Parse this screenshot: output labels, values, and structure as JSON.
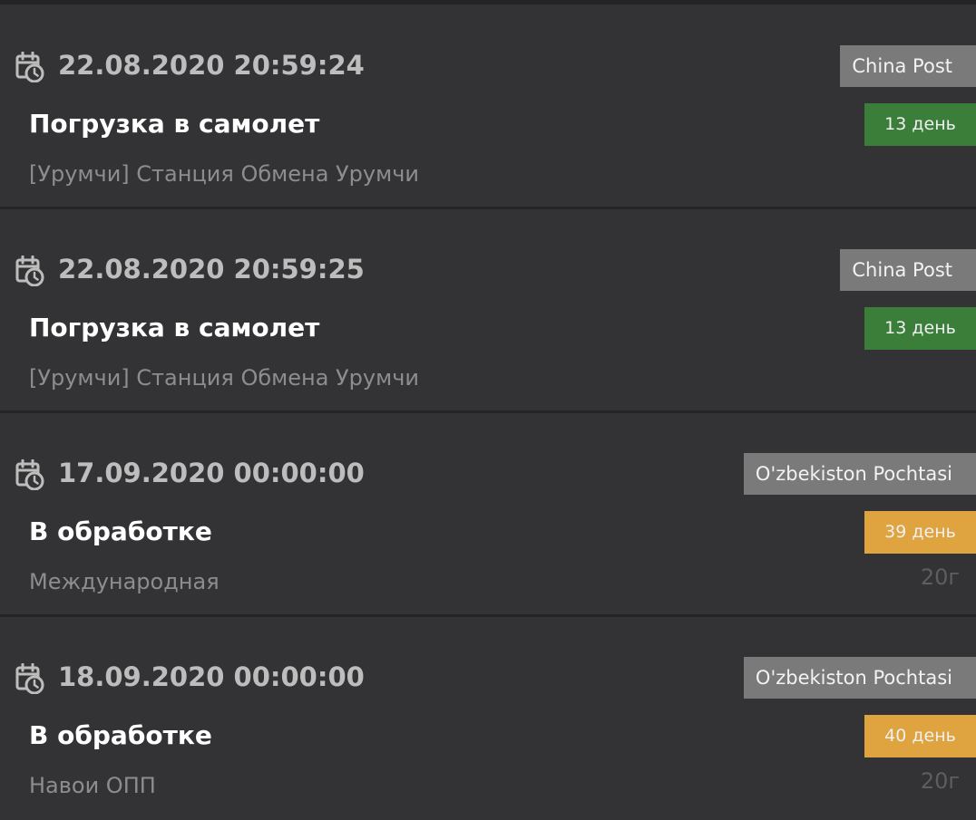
{
  "events": [
    {
      "datetime": "22.08.2020 20:59:24",
      "carrier": "China Post",
      "status": "Погрузка в самолет",
      "days": "13 день",
      "days_color": "#3b7e3a",
      "location": "[Урумчи] Станция Обмена Урумчи",
      "weight": "",
      "icon": "calendar-clock-icon"
    },
    {
      "datetime": "22.08.2020 20:59:25",
      "carrier": "China Post",
      "status": "Погрузка в самолет",
      "days": "13 день",
      "days_color": "#3b7e3a",
      "location": "[Урумчи] Станция Обмена Урумчи",
      "weight": "",
      "icon": "calendar-clock-icon"
    },
    {
      "datetime": "17.09.2020 00:00:00",
      "carrier": "O'zbekiston Pochtasi",
      "status": "В обработке",
      "days": "39 день",
      "days_color": "#dfa33f",
      "location": "Международная",
      "weight": "20г",
      "icon": "calendar-clock-icon"
    },
    {
      "datetime": "18.09.2020 00:00:00",
      "carrier": "O'zbekiston Pochtasi",
      "status": "В обработке",
      "days": "40 день",
      "days_color": "#dfa33f",
      "location": "Навои ОПП",
      "weight": "20г",
      "icon": "calendar-clock-icon"
    }
  ],
  "colors": {
    "background": "#333335",
    "separator": "#242426",
    "carrier_badge": "#7a7a7a",
    "days_green": "#3b7e3a",
    "days_amber": "#dfa33f"
  }
}
